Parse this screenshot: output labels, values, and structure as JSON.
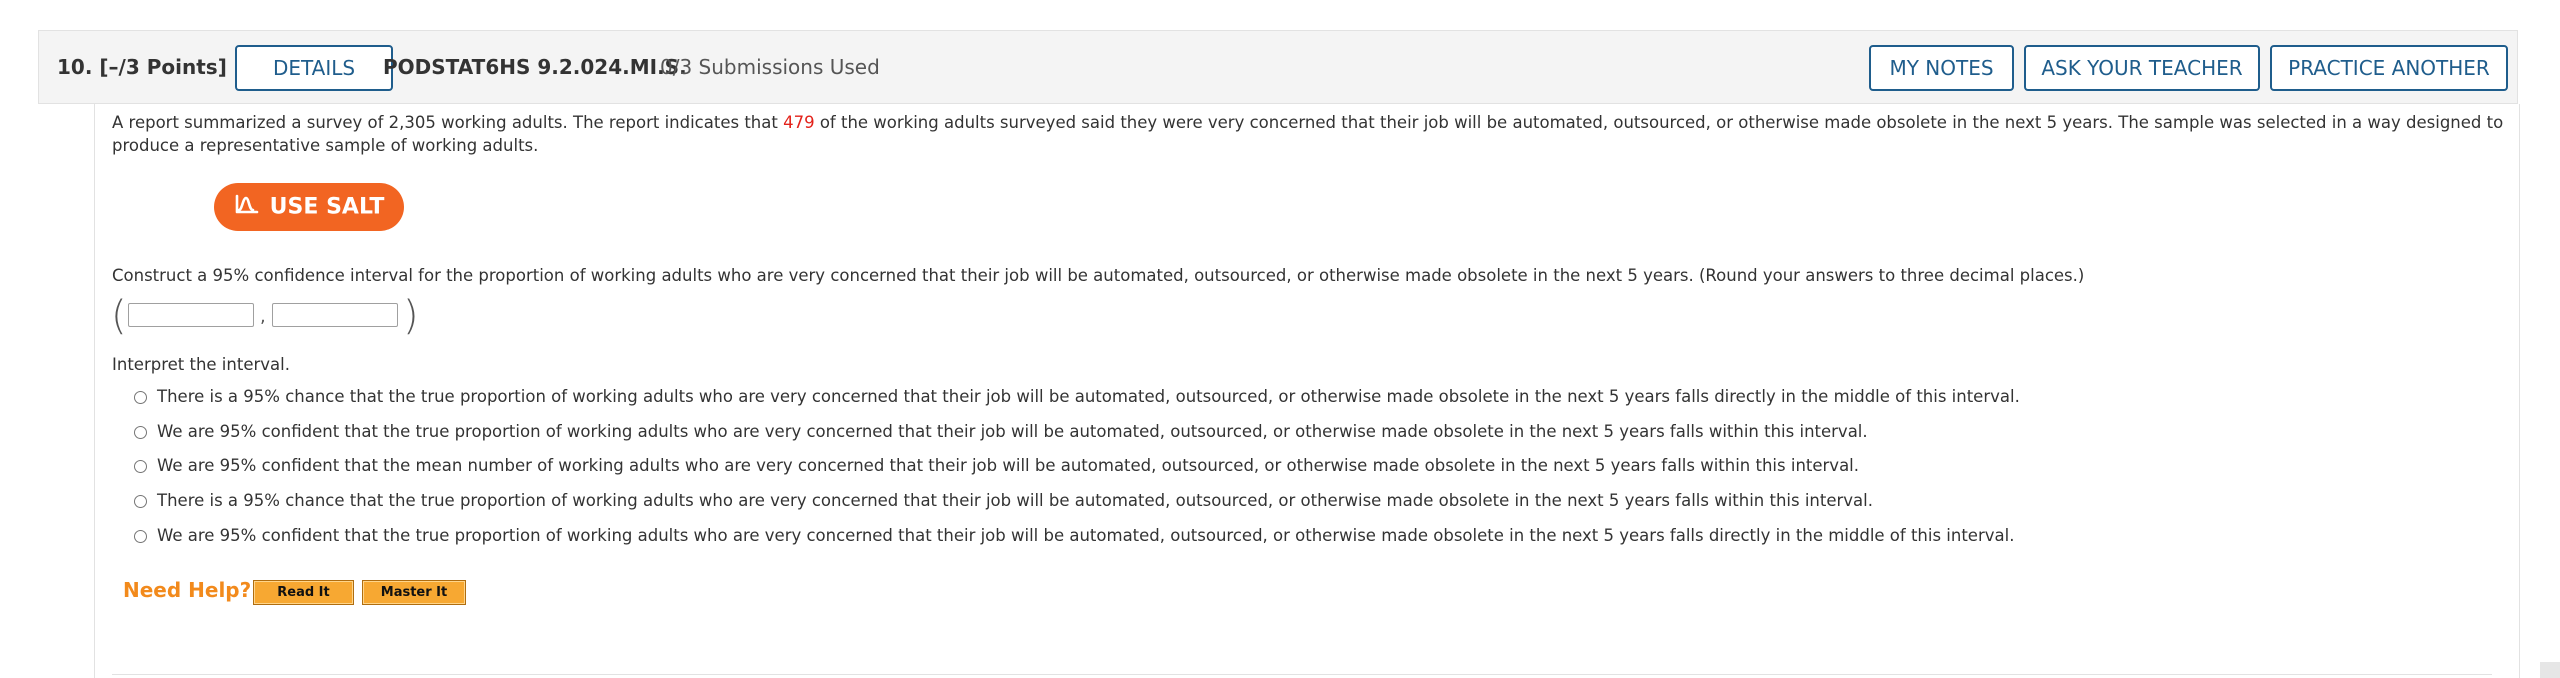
{
  "header": {
    "question_number": "10.",
    "points": "[–/3 Points]",
    "details_label": "DETAILS",
    "question_code": "PODSTAT6HS 9.2.024.MI.S.",
    "submissions": "0/3 Submissions Used",
    "my_notes_label": "MY NOTES",
    "ask_teacher_label": "ASK YOUR TEACHER",
    "practice_another_label": "PRACTICE ANOTHER"
  },
  "problem": {
    "intro_part1": "A report summarized a survey of 2,305 working adults. The report indicates that ",
    "highlight_value": "479",
    "intro_part2": " of the working adults surveyed said they were very concerned that their job will be automated, outsourced, or otherwise made obsolete in the next 5 years. The sample was selected in a way designed to",
    "intro_line2": "produce a representative sample of working adults.",
    "salt_label": "USE SALT",
    "construct_prompt": "Construct a 95% confidence interval for the proportion of working adults who are very concerned that their job will be automated, outsourced, or otherwise made obsolete in the next 5 years. (Round your answers to three decimal places.)",
    "interval": {
      "open_paren": "(",
      "separator": ",",
      "close_paren": ")",
      "lower_value": "",
      "upper_value": ""
    },
    "interpret_prompt": "Interpret the interval.",
    "options": [
      {
        "label": "There is a 95% chance that the true proportion of working adults who are very concerned that their job will be automated, outsourced, or otherwise made obsolete in the next 5 years falls directly in the middle of this interval."
      },
      {
        "label": "We are 95% confident that the true proportion of working adults who are very concerned that their job will be automated, outsourced, or otherwise made obsolete in the next 5 years falls within this interval."
      },
      {
        "label": "We are 95% confident that the mean number of working adults who are very concerned that their job will be automated, outsourced, or otherwise made obsolete in the next 5 years falls within this interval."
      },
      {
        "label": "There is a 95% chance that the true proportion of working adults who are very concerned that their job will be automated, outsourced, or otherwise made obsolete in the next 5 years falls within this interval."
      },
      {
        "label": "We are 95% confident that the true proportion of working adults who are very concerned that their job will be automated, outsourced, or otherwise made obsolete in the next 5 years falls directly in the middle of this interval."
      }
    ]
  },
  "help": {
    "need_help_label": "Need Help?",
    "read_it_label": "Read It",
    "master_it_label": "Master It"
  },
  "colors": {
    "accent_blue": "#1f5d8c",
    "salt_orange": "#f26522",
    "highlight_red": "#e3221a",
    "help_orange": "#f28a1c"
  },
  "icons": {
    "salt": "salt-logo-icon"
  }
}
